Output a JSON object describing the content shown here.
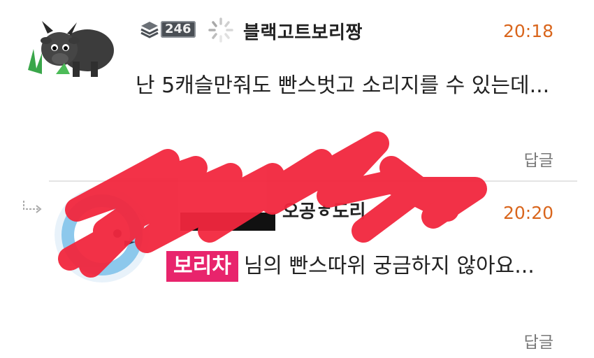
{
  "comment": {
    "level_badge": "246",
    "username": "블랙고트보리짱",
    "time": "20:18",
    "text": "난 5캐슬만줘도 빤스벗고 소리지를 수 있는데...",
    "reply_label": "답글"
  },
  "reply": {
    "username_partial": "오공ㅎ도리",
    "time": "20:20",
    "mention": "보리차",
    "text": "님의 빤스따위 궁금하지 않아요...",
    "reply_label": "답글"
  },
  "colors": {
    "time": "#d9661d",
    "mention_bg": "#e8246c",
    "scribble": "#f2273e"
  }
}
